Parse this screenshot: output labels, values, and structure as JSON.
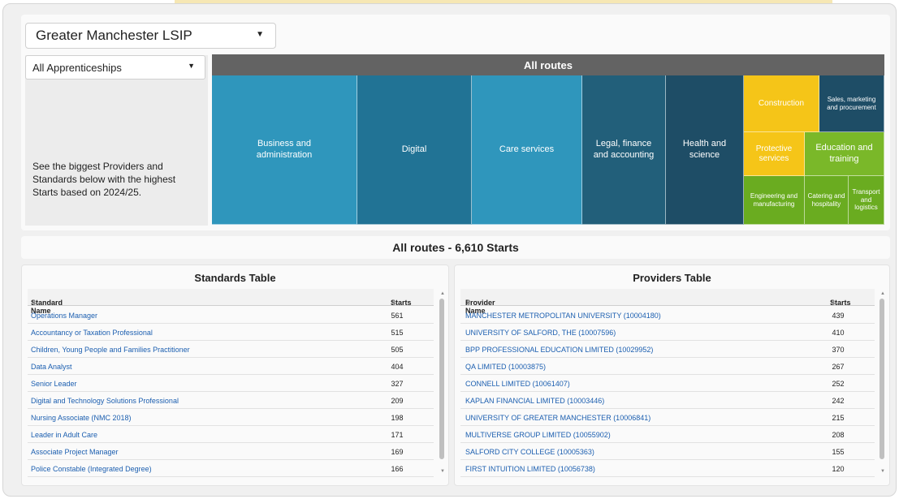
{
  "region_select": {
    "value": "Greater Manchester LSIP"
  },
  "apprenticeship_select": {
    "value": "All Apprenticeships"
  },
  "description": "See the biggest Providers and Standards below with the highest Starts based on 2024/25.",
  "treemap": {
    "title": "All routes",
    "tiles": [
      {
        "label": "Business and administration",
        "color": "#2f96bc"
      },
      {
        "label": "Digital",
        "color": "#217395"
      },
      {
        "label": "Care services",
        "color": "#2f96bc"
      },
      {
        "label": "Legal, finance and accounting",
        "color": "#225f7a"
      },
      {
        "label": "Health and science",
        "color": "#1e4d66"
      },
      {
        "label": "Construction",
        "color": "#f5c518"
      },
      {
        "label": "Sales, marketing and procurement",
        "color": "#1e4d66"
      },
      {
        "label": "Protective services",
        "color": "#f5c518"
      },
      {
        "label": "Education and training",
        "color": "#7ab829"
      },
      {
        "label": "Engineering and manufacturing",
        "color": "#6aac20"
      },
      {
        "label": "Catering and hospitality",
        "color": "#6aac20"
      },
      {
        "label": "Transport and logistics",
        "color": "#6aac20"
      }
    ]
  },
  "summary": "All routes - 6,610 Starts",
  "standards": {
    "title": "Standards Table",
    "col_name": "Standard Name",
    "col_starts": "Starts",
    "rows": [
      {
        "name": "Operations Manager",
        "starts": "561"
      },
      {
        "name": "Accountancy or Taxation Professional",
        "starts": "515"
      },
      {
        "name": "Children, Young People and Families Practitioner",
        "starts": "505"
      },
      {
        "name": "Data Analyst",
        "starts": "404"
      },
      {
        "name": "Senior Leader",
        "starts": "327"
      },
      {
        "name": "Digital and Technology Solutions Professional",
        "starts": "209"
      },
      {
        "name": "Nursing Associate (NMC 2018)",
        "starts": "198"
      },
      {
        "name": "Leader in Adult Care",
        "starts": "171"
      },
      {
        "name": "Associate Project Manager",
        "starts": "169"
      },
      {
        "name": "Police Constable (Integrated Degree)",
        "starts": "166"
      }
    ]
  },
  "providers": {
    "title": "Providers Table",
    "col_name": "Provider Name",
    "col_starts": "Starts",
    "rows": [
      {
        "name": "MANCHESTER METROPOLITAN UNIVERSITY (10004180)",
        "starts": "439"
      },
      {
        "name": "UNIVERSITY OF SALFORD, THE (10007596)",
        "starts": "410"
      },
      {
        "name": "BPP PROFESSIONAL EDUCATION LIMITED (10029952)",
        "starts": "370"
      },
      {
        "name": "QA LIMITED (10003875)",
        "starts": "267"
      },
      {
        "name": "CONNELL LIMITED (10061407)",
        "starts": "252"
      },
      {
        "name": "KAPLAN FINANCIAL LIMITED (10003446)",
        "starts": "242"
      },
      {
        "name": "UNIVERSITY OF GREATER MANCHESTER (10006841)",
        "starts": "215"
      },
      {
        "name": "MULTIVERSE GROUP LIMITED (10055902)",
        "starts": "208"
      },
      {
        "name": "SALFORD CITY COLLEGE (10005363)",
        "starts": "155"
      },
      {
        "name": "FIRST INTUITION LIMITED (10056738)",
        "starts": "120"
      }
    ]
  }
}
